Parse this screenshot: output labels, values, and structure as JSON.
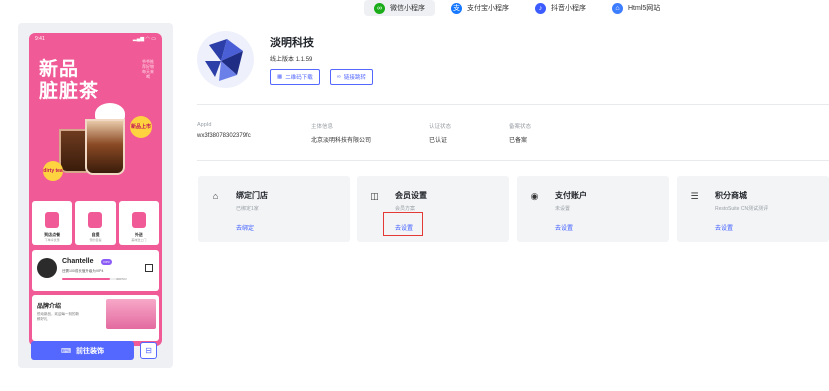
{
  "platform_tabs": [
    {
      "label": "微信小程序",
      "icon": "wechat-miniprogram-icon",
      "color": "#1aad19",
      "active": true
    },
    {
      "label": "支付宝小程序",
      "icon": "alipay-icon",
      "color": "#1677ff",
      "active": false
    },
    {
      "label": "抖音小程序",
      "icon": "douyin-icon",
      "color": "#3d5cff",
      "active": false
    },
    {
      "label": "Html5网站",
      "icon": "html5-icon",
      "color": "#3d7dff",
      "active": false
    }
  ],
  "preview": {
    "status_time": "9:41",
    "status_icons": "▂▄▆ ◠ ▭",
    "hero_title_1": "新品",
    "hero_title_2": "脏脏茶",
    "hero_vertical": "爷爷推荐好物每天来喝",
    "badge_new": "新品上市",
    "badge_dirty": "dirty tea",
    "services": [
      {
        "name": "到店点餐",
        "sub": "下单享优惠"
      },
      {
        "name": "自提",
        "sub": "预约自提"
      },
      {
        "name": "外送",
        "sub": "美味送上门"
      }
    ],
    "member": {
      "name": "Chantelle",
      "vip": "VIP3",
      "desc": "还需100成长值升级为VIP4",
      "count": "400/500",
      "progress": 0.8
    },
    "brand": {
      "title": "品牌介绍",
      "desc": "悦动新品，欢迎每一刻的新鲜好礼"
    },
    "decorate_button": "前往装饰",
    "decorate_icon": "brush-icon",
    "share_icon": "share-icon"
  },
  "store": {
    "name": "淡明科技",
    "version_label": "线上版本",
    "version": "1.1.59",
    "qr_button": "二维码下载",
    "link_button": "链接跳转"
  },
  "info": [
    {
      "label": "AppId",
      "value": "wx3f38078302379fc"
    },
    {
      "label": "主体信息",
      "value": "北京淡明科技有限公司"
    },
    {
      "label": "认证状态",
      "value": "已认证"
    },
    {
      "label": "备案状态",
      "value": "已备案"
    }
  ],
  "cards": [
    {
      "title": "绑定门店",
      "sub": "已绑定1家",
      "link": "去绑定",
      "icon": "store-icon"
    },
    {
      "title": "会员设置",
      "sub": "会员方案",
      "link": "去设置",
      "icon": "member-card-icon"
    },
    {
      "title": "支付账户",
      "sub": "未设置",
      "link": "去设置",
      "icon": "payment-icon"
    },
    {
      "title": "积分商城",
      "sub": "RestoSuite CN测试测评",
      "link": "去设置",
      "icon": "points-coins-icon"
    }
  ]
}
